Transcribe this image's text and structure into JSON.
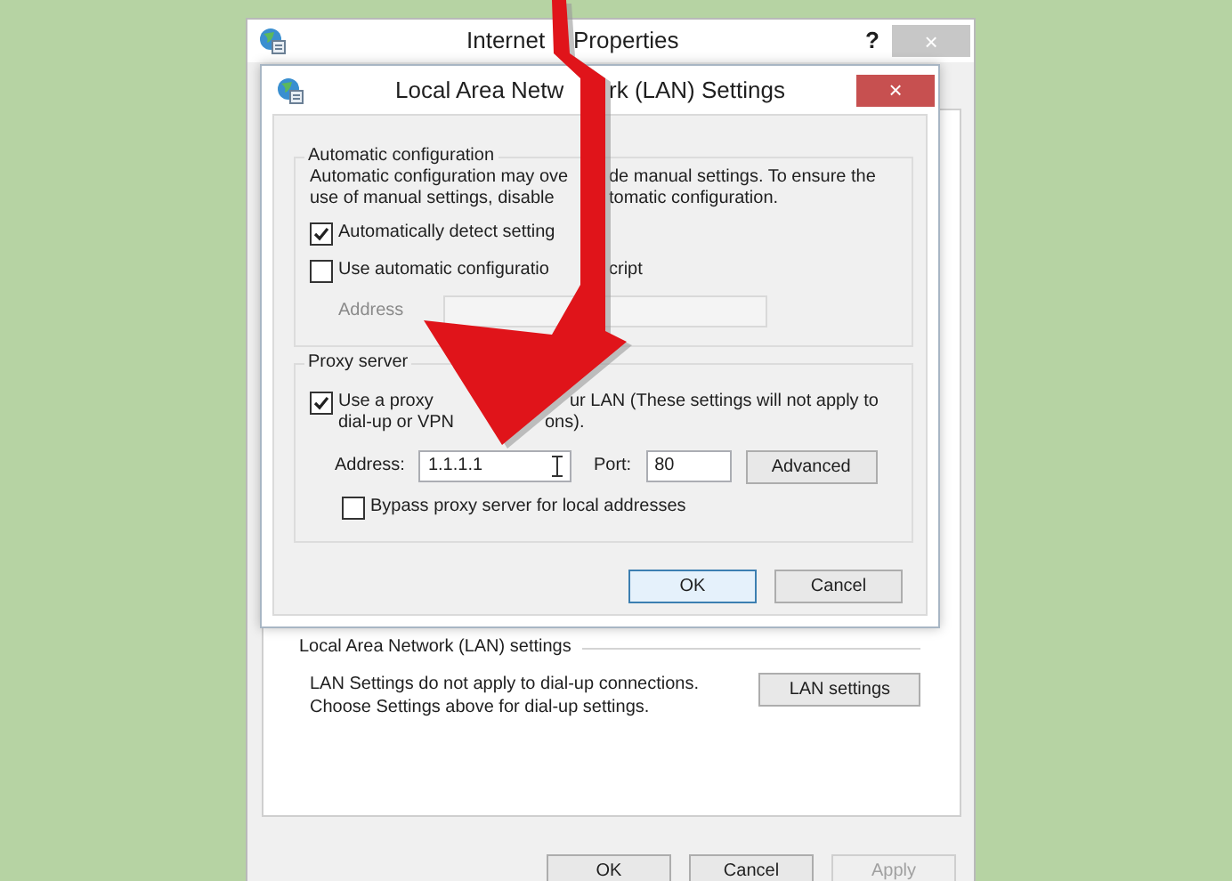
{
  "background_window": {
    "title": [
      "Internet",
      "Properties"
    ],
    "help": "?",
    "close": "×",
    "lan_group": {
      "title": "Local Area Network (LAN) settings",
      "description": "LAN Settings do not apply to dial-up connections. Choose Settings above for dial-up settings.",
      "button": "LAN settings"
    },
    "buttons": [
      {
        "label": "OK",
        "disabled": false
      },
      {
        "label": "Cancel",
        "disabled": false
      },
      {
        "label": "Apply",
        "disabled": true
      }
    ]
  },
  "dialog": {
    "title": [
      "Local Area Netw",
      "rk (LAN) Settings"
    ],
    "close": "×",
    "automatic_configuration": {
      "title": "Automatic configuration",
      "description": [
        [
          "Automatic configuration may ove",
          "de manual settings.  To ensure the"
        ],
        [
          "use of manual settings, disable",
          "tomatic configuration."
        ]
      ],
      "options": [
        {
          "label": [
            "Automatically detect setting"
          ],
          "checked": true
        },
        {
          "label": [
            "Use automatic configuratio",
            "cript"
          ],
          "checked": false
        }
      ],
      "address": {
        "label": "Address",
        "disabled": true
      }
    },
    "proxy_server": {
      "title": "Proxy server",
      "use_proxy": {
        "label": [
          [
            "Use a proxy",
            "ur LAN (These settings will not apply to"
          ],
          [
            "dial-up or VPN",
            "ons)."
          ]
        ],
        "checked": true
      },
      "address": {
        "label": "Address:",
        "value": "1.1.1.1"
      },
      "port": {
        "label": "Port:",
        "value": "80"
      },
      "advanced": "Advanced",
      "bypass": {
        "label": "Bypass proxy server for local addresses",
        "checked": false
      }
    },
    "buttons": [
      "OK",
      "Cancel"
    ]
  }
}
